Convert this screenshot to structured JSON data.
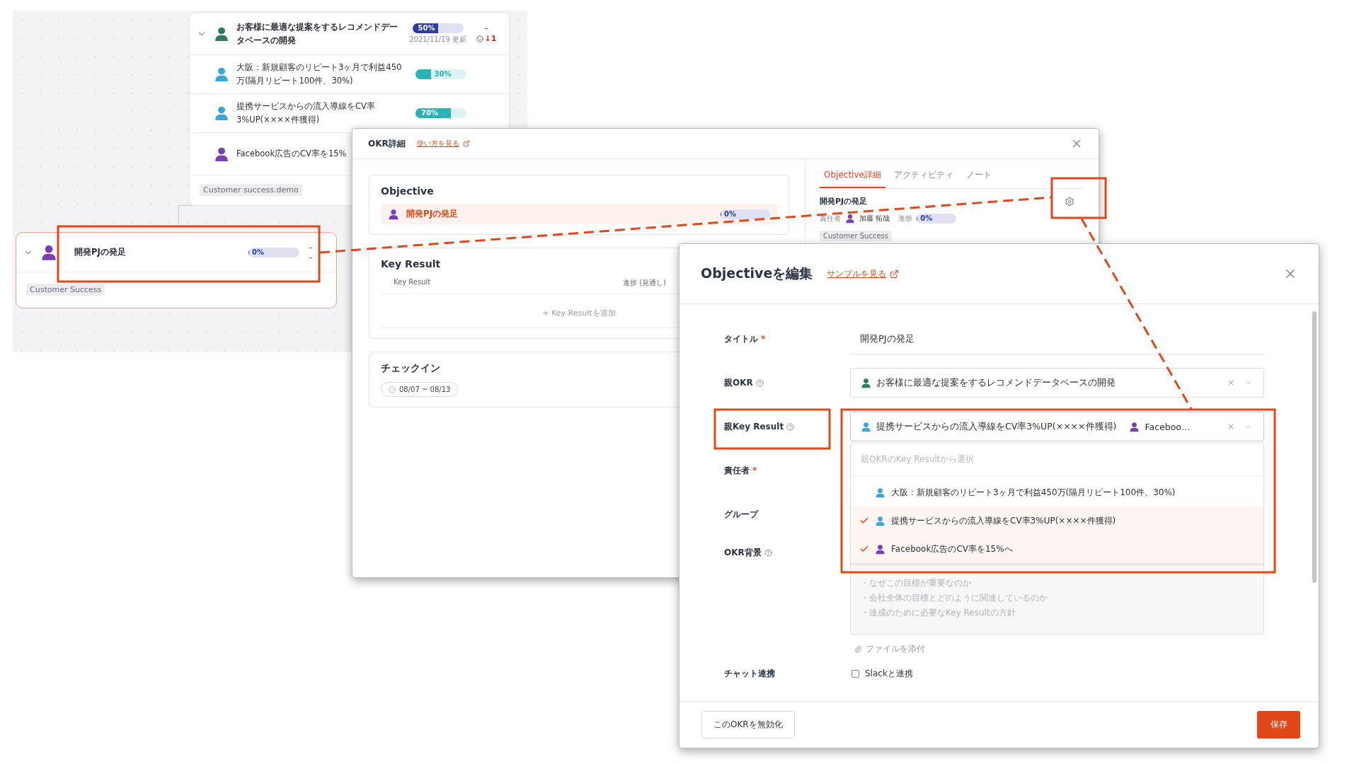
{
  "board": {
    "parent_card": {
      "rows": [
        {
          "kind": "objective",
          "title": "お客様に最適な提案をするレコメンドデータベースの開発",
          "color": "#2e7d5b",
          "level": 0.5,
          "progress": "50%",
          "updated": "2021/11/19 更新",
          "dash": "–",
          "trend": "↓1"
        },
        {
          "kind": "key_result",
          "title": "大阪：新規顧客のリピート3ヶ月で利益450万(隔月リピート100件、30%)",
          "color": "#3aa6e0",
          "level": 0.3,
          "progress": "30%"
        },
        {
          "kind": "key_result",
          "title": "提携サービスからの流入導線をCV率3%UP(××××件獲得)",
          "color": "#3aa6e0",
          "level": 0.7,
          "progress": "70%"
        },
        {
          "kind": "key_result",
          "title": "Facebook広告のCV率を15%",
          "color": "#7b3fb5"
        }
      ],
      "tag": "Customer success.demo"
    },
    "child_card": {
      "title": "開発PJの発足",
      "color": "#7b3fb5",
      "level": 0,
      "progress": "0%",
      "dashes": [
        "–",
        "–"
      ],
      "tag": "Customer Success"
    }
  },
  "okr_detail": {
    "title": "OKR詳細",
    "help_link": "使い方を見る",
    "objective": {
      "heading": "Objective",
      "title": "開発PJの発足",
      "color": "#7b3fb5",
      "level": 0,
      "progress": "0%"
    },
    "key_results": {
      "heading": "Key Result",
      "columns": [
        "Key Result",
        "進捗 (見通し)"
      ],
      "add": "+ Key Resultを追加"
    },
    "checkin": {
      "heading": "チェックイン",
      "period": "08/07 ~ 08/13"
    },
    "tabs": [
      {
        "label": "Objective詳細",
        "selected": true
      },
      {
        "label": "アクティビティ",
        "selected": false
      },
      {
        "label": "ノート",
        "selected": false
      }
    ],
    "side": {
      "title": "開発PJの発足",
      "owner_label": "責任者",
      "owner": {
        "name": "加藤 拓哉",
        "color": "#7b3fb5"
      },
      "progress_label": "進捗",
      "level": 0,
      "progress": "0%",
      "tag": "Customer Success"
    }
  },
  "edit_dialog": {
    "title": "Objectiveを編集",
    "sample_link": "サンプルを見る",
    "fields": [
      {
        "kind": "text",
        "label": "タイトル",
        "required_mark": "*",
        "value": "開発PJの発足"
      },
      {
        "kind": "select",
        "label": "親OKR",
        "help": true,
        "items": [
          {
            "text": "お客様に最適な提案をするレコメンドデータベースの開発",
            "color": "#2e7d5b"
          }
        ],
        "expanded": false
      },
      {
        "kind": "select",
        "label": "親Key Result",
        "help": true,
        "items": [
          {
            "text": "提携サービスからの流入導線をCV率3%UP(××××件獲得)",
            "color": "#3aa6e0"
          },
          {
            "text": "Faceboo…",
            "color": "#7b3fb5"
          }
        ],
        "expanded": true
      },
      {
        "kind": "empty",
        "label": "責任者",
        "required_mark": "*"
      },
      {
        "kind": "empty",
        "label": "グループ"
      },
      {
        "kind": "textarea",
        "label": "OKR背景",
        "help": true,
        "placeholder_lines": [
          "・なぜこの目標が重要なのか",
          "・会社全体の目標とどのように関連しているのか",
          "・達成のために必要なKey Resultの方針"
        ],
        "attach": "ファイルを添付"
      },
      {
        "kind": "checkbox",
        "label": "チャット連携",
        "option": "Slackと連携",
        "checked": false
      }
    ],
    "dropdown": {
      "placeholder": "親OKRのKey Resultから選択",
      "options": [
        {
          "text": "大阪：新規顧客のリピート3ヶ月で利益450万(隔月リピート100件、30%)",
          "color": "#3aa6e0",
          "selected": false
        },
        {
          "text": "提携サービスからの流入導線をCV率3%UP(××××件獲得)",
          "color": "#3aa6e0",
          "selected": true
        },
        {
          "text": "Facebook広告のCV率を15%へ",
          "color": "#7b3fb5",
          "selected": true
        }
      ]
    },
    "disable_button": "このOKRを無効化",
    "save_button": "保存"
  }
}
